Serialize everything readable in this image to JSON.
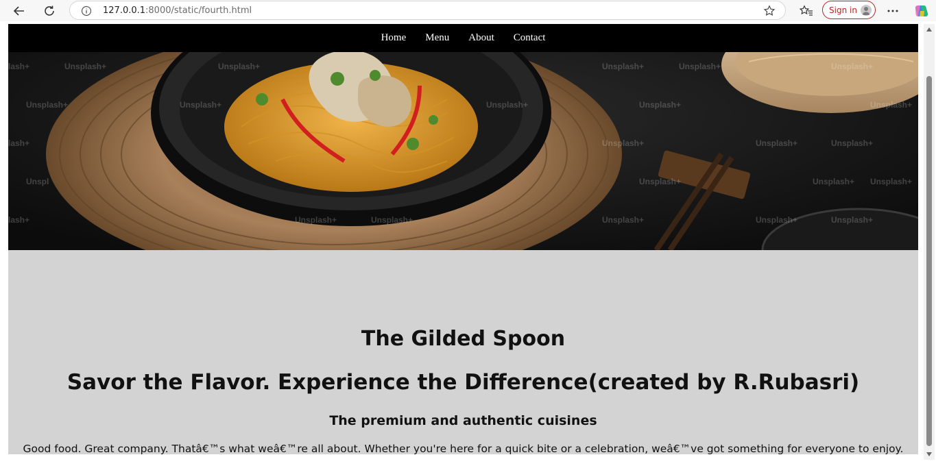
{
  "browser": {
    "url_host": "127.0.0.1",
    "url_path": ":8000/static/fourth.html",
    "signin_label": "Sign in"
  },
  "nav": {
    "items": [
      "Home",
      "Menu",
      "About",
      "Contact"
    ]
  },
  "hero": {
    "watermark": "Unsplash+"
  },
  "main": {
    "title": "The Gilded Spoon",
    "tagline": "Savor the Flavor. Experience the Difference(created by R.Rubasri)",
    "subtitle": "The premium and authentic cuisines",
    "intro": "Good food. Great company. Thatâ€™s what weâ€™re all about. Whether you're here for a quick bite or a celebration, weâ€™ve got something for everyone to enjoy."
  },
  "colors": {
    "nav_bg": "#000000",
    "content_bg": "#d3d3d3",
    "signin_accent": "#b3261e"
  }
}
